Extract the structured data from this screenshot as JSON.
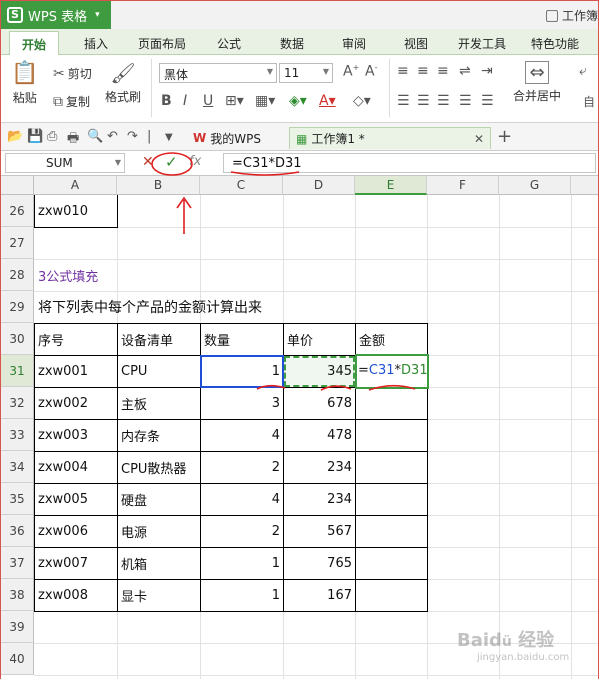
{
  "title_bar": {
    "app_button": "WPS 表格",
    "window_title": "工作簿"
  },
  "ribbon_tabs": [
    "开始",
    "插入",
    "页面布局",
    "公式",
    "数据",
    "审阅",
    "视图",
    "开发工具",
    "特色功能"
  ],
  "ribbon": {
    "paste": "粘贴",
    "cut": "剪切",
    "copy": "复制",
    "format_painter": "格式刷",
    "font_name": "黑体",
    "font_size": "11",
    "merge_center": "合并居中"
  },
  "doc_tabs": [
    {
      "label": "我的WPS"
    },
    {
      "label": "工作簿1 *"
    }
  ],
  "formula_bar": {
    "name_box": "SUM",
    "formula": "=C31*D31"
  },
  "columns": [
    "A",
    "B",
    "C",
    "D",
    "E",
    "F",
    "G"
  ],
  "rows": [
    "26",
    "27",
    "28",
    "29",
    "30",
    "31",
    "32",
    "33",
    "34",
    "35",
    "36",
    "37",
    "38",
    "39",
    "40"
  ],
  "cells": {
    "a26": "zxw010",
    "a28": "3公式填充",
    "a29": "将下列表中每个产品的金额计算出来"
  },
  "table": {
    "headers": [
      "序号",
      "设备清单",
      "数量",
      "单价",
      "金额"
    ],
    "rows": [
      [
        "zxw001",
        "CPU",
        "1",
        "345",
        "=C31*D31"
      ],
      [
        "zxw002",
        "主板",
        "3",
        "678",
        ""
      ],
      [
        "zxw003",
        "内存条",
        "4",
        "478",
        ""
      ],
      [
        "zxw004",
        "CPU散热器",
        "2",
        "234",
        ""
      ],
      [
        "zxw005",
        "硬盘",
        "4",
        "234",
        ""
      ],
      [
        "zxw006",
        "电源",
        "2",
        "567",
        ""
      ],
      [
        "zxw007",
        "机箱",
        "1",
        "765",
        ""
      ],
      [
        "zxw008",
        "显卡",
        "1",
        "167",
        ""
      ]
    ]
  },
  "edit_formula_parts": {
    "eq": "=",
    "ref1": "C31",
    "op": "*",
    "ref2": "D31"
  },
  "colors": {
    "accent": "#3f9b3f",
    "ref_blue": "#1f4fd6",
    "ref_green": "#2e8b2e",
    "annotation_red": "#e02020"
  },
  "watermark": "Baidu 经验 jingyan.baidu.com"
}
